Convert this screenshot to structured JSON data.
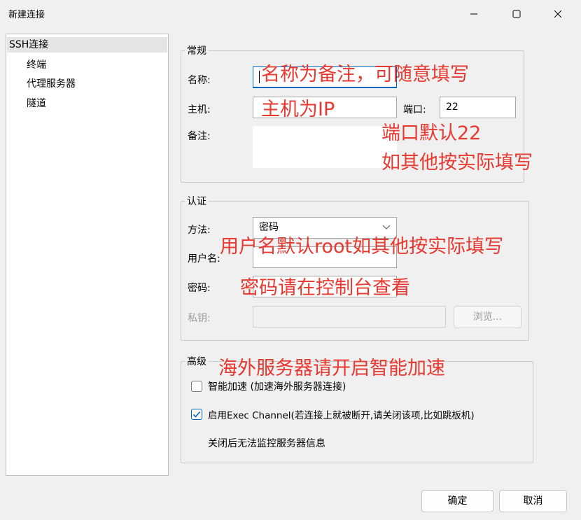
{
  "window": {
    "title": "新建连接",
    "minimize_icon": "minimize-icon",
    "maximize_icon": "maximize-icon",
    "close_icon": "close-icon"
  },
  "sidebar": {
    "items": [
      {
        "label": "SSH连接",
        "selected": true
      },
      {
        "label": "终端"
      },
      {
        "label": "代理服务器"
      },
      {
        "label": "隧道"
      }
    ]
  },
  "general": {
    "legend": "常规",
    "name_label": "名称:",
    "name_value": "",
    "host_label": "主机:",
    "host_value": "",
    "port_label": "端口:",
    "port_value": "22",
    "note_label": "备注:",
    "note_value": ""
  },
  "auth": {
    "legend": "认证",
    "method_label": "方法:",
    "method_value": "密码",
    "username_label": "用户名:",
    "username_value": "",
    "password_label": "密码:",
    "password_value": "",
    "key_label": "私钥:",
    "key_value": "",
    "browse_label": "浏览..."
  },
  "advanced": {
    "legend": "高级",
    "smart_accel_label": "智能加速 (加速海外服务器连接)",
    "smart_accel_checked": false,
    "exec_channel_label": "启用Exec Channel(若连接上就被断开,请关闭该项,比如跳板机)",
    "exec_channel_checked": true,
    "exec_channel_note": "关闭后无法监控服务器信息"
  },
  "footer": {
    "ok_label": "确定",
    "cancel_label": "取消"
  },
  "annotations": {
    "name_hint": "名称为备注，可随意填写",
    "host_hint": "主机为IP",
    "port_hint": "端口默认22",
    "port_hint2": "如其他按实际填写",
    "user_hint": "用户名默认root如其他按实际填写",
    "password_hint": "密码请在控制台查看",
    "advanced_hint": "海外服务器请开启智能加速",
    "color": "#e8382f"
  },
  "colors": {
    "accent": "#0067c0",
    "background": "#f0f0f0"
  }
}
